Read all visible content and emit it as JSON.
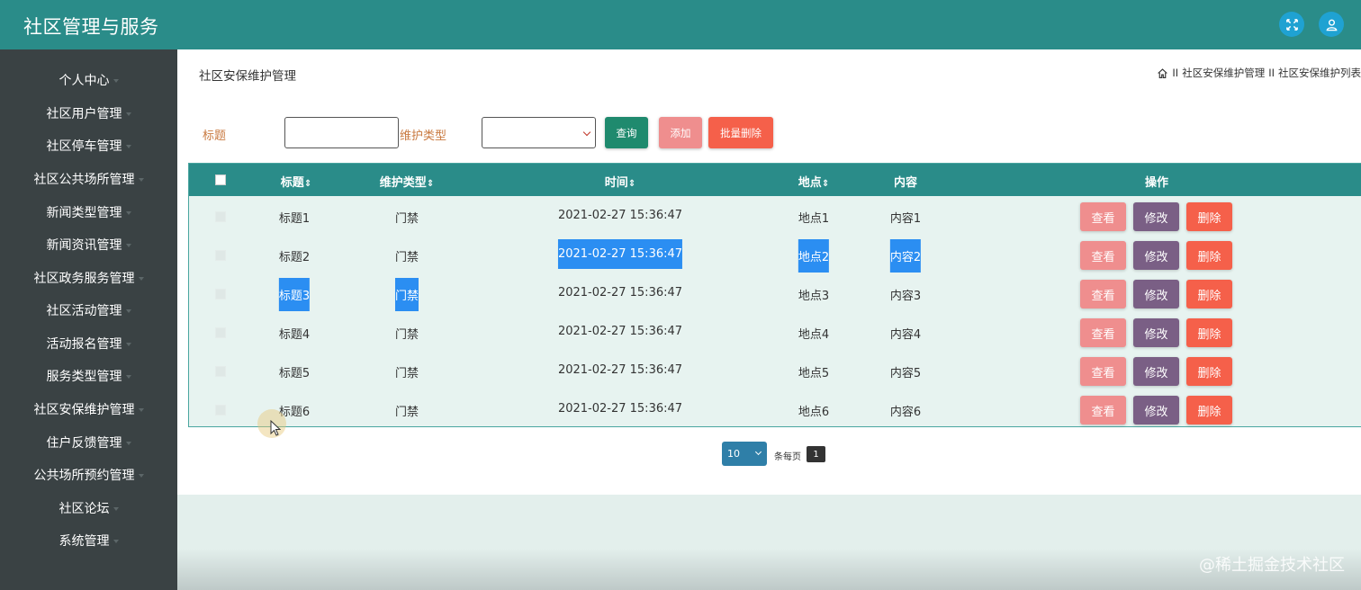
{
  "app": {
    "title": "社区管理与服务"
  },
  "header": {
    "fullscreen_icon": "fullscreen-icon",
    "user_icon": "user-icon"
  },
  "sidebar": {
    "items": [
      {
        "label": "个人中心"
      },
      {
        "label": "社区用户管理"
      },
      {
        "label": "社区停车管理"
      },
      {
        "label": "社区公共场所管理"
      },
      {
        "label": "新闻类型管理"
      },
      {
        "label": "新闻资讯管理"
      },
      {
        "label": "社区政务服务管理"
      },
      {
        "label": "社区活动管理"
      },
      {
        "label": "活动报名管理"
      },
      {
        "label": "服务类型管理"
      },
      {
        "label": "社区安保维护管理"
      },
      {
        "label": "住户反馈管理"
      },
      {
        "label": "公共场所预约管理"
      },
      {
        "label": "社区论坛"
      },
      {
        "label": "系统管理"
      }
    ]
  },
  "page": {
    "title": "社区安保维护管理",
    "breadcrumb": {
      "sep": "II",
      "level1": "社区安保维护管理",
      "level2": "社区安保维护列表"
    }
  },
  "search": {
    "title_label": "标题",
    "title_value": "",
    "type_label": "维护类型",
    "type_value": "",
    "query_button": "查询",
    "add_button": "添加",
    "batch_delete_button": "批量删除"
  },
  "table": {
    "columns": [
      "标题",
      "维护类型",
      "时间",
      "地点",
      "内容",
      "操作"
    ],
    "sort_glyph": "⇕",
    "rows": [
      {
        "title": "标题1",
        "type": "门禁",
        "time": "2021-02-27 15:36:47",
        "place": "地点1",
        "content": "内容1"
      },
      {
        "title": "标题2",
        "type": "门禁",
        "time": "2021-02-27 15:36:47",
        "place": "地点2",
        "content": "内容2"
      },
      {
        "title": "标题3",
        "type": "门禁",
        "time": "2021-02-27 15:36:47",
        "place": "地点3",
        "content": "内容3"
      },
      {
        "title": "标题4",
        "type": "门禁",
        "time": "2021-02-27 15:36:47",
        "place": "地点4",
        "content": "内容4"
      },
      {
        "title": "标题5",
        "type": "门禁",
        "time": "2021-02-27 15:36:47",
        "place": "地点5",
        "content": "内容5"
      },
      {
        "title": "标题6",
        "type": "门禁",
        "time": "2021-02-27 15:36:47",
        "place": "地点6",
        "content": "内容6"
      }
    ],
    "actions": {
      "view": "查看",
      "edit": "修改",
      "delete": "删除"
    }
  },
  "pagination": {
    "page_size": "10",
    "per_page_label": "条每页",
    "current_page": "1"
  },
  "watermark": "@稀土掘金技术社区",
  "colors": {
    "header": "#2a8c89",
    "sidebar": "#3a4244",
    "label": "#c97a41",
    "query": "#1f8a6e",
    "add": "#ef8e8e",
    "batch_delete": "#f5604a",
    "view": "#ef8e8e",
    "edit": "#7a5f85",
    "delete": "#f5604a",
    "highlight": "#2b8ef2"
  }
}
